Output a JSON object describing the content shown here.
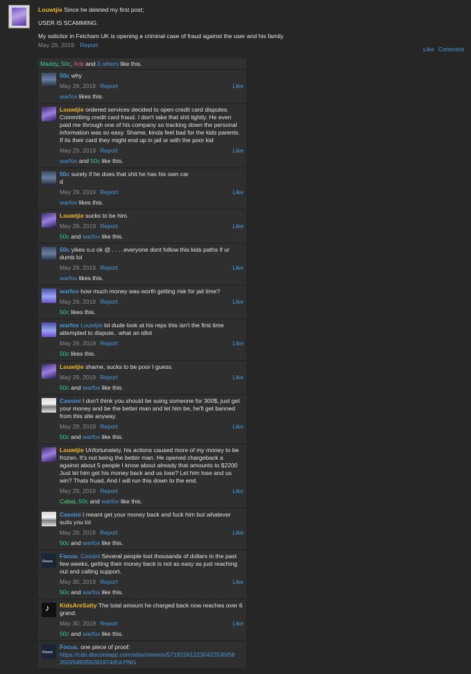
{
  "post": {
    "author": "Louwtjie",
    "first_line": "Since he deleted my first post;",
    "line2": "USER IS SCAMMING.",
    "line3": "My solicitor in Fetcham UK is opening a criminal case of fraud against the user and his family.",
    "date": "May 29, 2019",
    "report": "Report",
    "like": "Like",
    "comment": "Comment",
    "likes": {
      "u1": "Maddy",
      "sep1": ",",
      "u2": "50c",
      "sep2": ",",
      "u3": "Arik",
      "and": "and",
      "others": "3 others",
      "tail": "like this."
    }
  },
  "comments": [
    {
      "author": "50c",
      "lines": [
        "why"
      ],
      "date": "May 29, 2019",
      "likes_a": "warfox",
      "likes_b": "",
      "likes_tail": "likes this."
    },
    {
      "author": "Louwtjie",
      "lines": [
        "ordered services decided to open credit card disputes.",
        "Committing credit card fraud. I don't take that shit lightly. He even",
        "paid me through one of his company so tracking down the personal",
        "information was so easy. Shame, kinda feel bad for the kids parents.",
        "If its their card they might end up in jail or with the poor kid"
      ],
      "date": "May 29, 2019",
      "likes_a": "warfox",
      "likes_b": "50c",
      "likes_tail": "like this."
    },
    {
      "author": "50c",
      "lines": [
        "surely if he does that shit he has his own car",
        "d"
      ],
      "date": "May 29, 2019",
      "likes_a": "warfox",
      "likes_b": "",
      "likes_tail": "likes this."
    },
    {
      "author": "Louwtjie",
      "lines": [
        "sucks to be him."
      ],
      "date": "May 29, 2019",
      "likes_a": "50c",
      "likes_b": "warfox",
      "likes_tail": "like this."
    },
    {
      "author": "50c",
      "lines": [
        "yikes o.o ok @ . . . .everyone dont follow this kids paths if ur",
        "dumb lol"
      ],
      "date": "May 29, 2019",
      "likes_a": "warfox",
      "likes_b": "",
      "likes_tail": "likes this."
    },
    {
      "author": "warfox",
      "lines": [
        "how much money was worth getting risk for jail time?"
      ],
      "date": "May 29, 2019",
      "likes_a": "50c",
      "likes_b": "",
      "likes_tail": "likes this."
    },
    {
      "author": "warfox",
      "mention": "Louwtjie",
      "lines": [
        "lol dude look at his reps this isn't the first time",
        "attempted to dispute.. what an idiot"
      ],
      "date": "May 29, 2019",
      "likes_a": "50c",
      "likes_b": "",
      "likes_tail": "likes this."
    },
    {
      "author": "Louwtjie",
      "lines": [
        "shame, sucks to be poor I guess."
      ],
      "date": "May 29, 2019",
      "likes_a": "50c",
      "likes_b": "warfox",
      "likes_tail": "like this."
    },
    {
      "author": "Cassini",
      "lines": [
        "I don't think you should be suing someone for 300$, just get",
        "your money and be the better man and let him be, he'll get banned",
        "from this site anyway."
      ],
      "date": "May 29, 2019",
      "likes_a": "50c",
      "likes_b": "warfox",
      "likes_tail": "like this."
    },
    {
      "author": "Louwtjie",
      "lines": [
        "Unfortunately, his actions caused more of my money to be",
        "frozen. It's not being the better man. He opened chargeback a",
        "against about 5 people I know about already that amounts to $2200",
        "Just let him get his money back and us lose? Let him lose and us",
        "win? Thats fruad, And I will run this down to the end."
      ],
      "date": "May 29, 2019",
      "likes_c": "Cabal",
      "likes_a": "50c",
      "likes_b": "warfox",
      "likes_tail": "like this."
    },
    {
      "author": "Cassini",
      "lines": [
        "I meant get your money back and fuck him but whatever",
        "suits you lol"
      ],
      "date": "May 29, 2019",
      "likes_a": "50c",
      "likes_b": "warfox",
      "likes_tail": "like this."
    },
    {
      "author": "Focus.",
      "mention": "Cassini",
      "lines": [
        "Several people lost thousands of dollars in the past",
        "few weeks, getting their money back is not as easy as just reaching",
        "out and calling support."
      ],
      "date": "May 30, 2019",
      "likes_a": "50c",
      "likes_b": "warfox",
      "likes_tail": "like this."
    },
    {
      "author": "KidsAreSalty",
      "lines": [
        "The total amount he charged back now reaches over 6",
        "grand."
      ],
      "date": "May 30, 2019",
      "likes_a": "50c",
      "likes_b": "warfox",
      "likes_tail": "like this."
    },
    {
      "author": "Focus.",
      "lines": [
        "one piece of proof:"
      ],
      "link_lines": [
        "https://cdn.discordapp.com/attachments/571922612230422530/58",
        "3502549355261974/Ed.PNG"
      ]
    }
  ],
  "ui": {
    "report": "Report",
    "like": "Like",
    "and": "and",
    "focus_logo": "Focus"
  }
}
